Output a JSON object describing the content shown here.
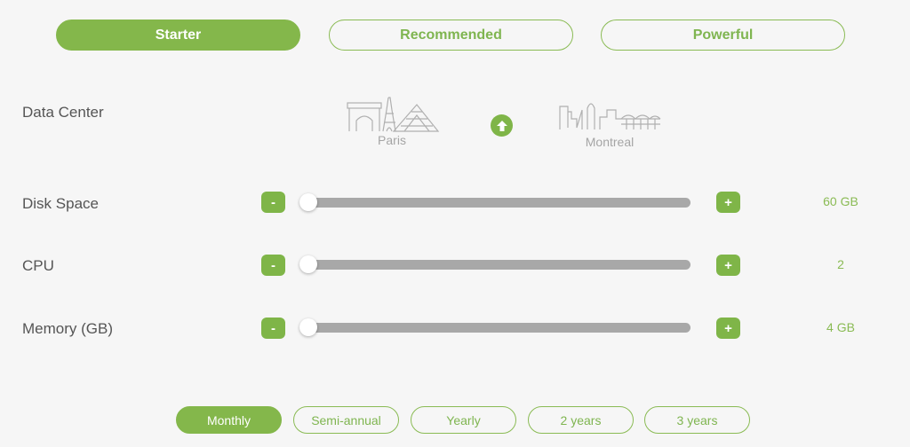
{
  "plans": [
    {
      "label": "Starter",
      "active": true
    },
    {
      "label": "Recommended",
      "active": false
    },
    {
      "label": "Powerful",
      "active": false
    }
  ],
  "data_center": {
    "label": "Data Center",
    "cities": [
      "Paris",
      "Montreal"
    ],
    "swap_icon": "arrow-up-icon"
  },
  "resources": [
    {
      "label": "Disk Space",
      "value": "60 GB",
      "slider_fraction": 0,
      "minus": "-",
      "plus": "+"
    },
    {
      "label": "CPU",
      "value": "2",
      "slider_fraction": 0,
      "minus": "-",
      "plus": "+"
    },
    {
      "label": "Memory (GB)",
      "value": "4 GB",
      "slider_fraction": 0,
      "minus": "-",
      "plus": "+"
    }
  ],
  "periods": [
    {
      "label": "Monthly",
      "active": true
    },
    {
      "label": "Semi-annual",
      "active": false
    },
    {
      "label": "Yearly",
      "active": false
    },
    {
      "label": "2 years",
      "active": false
    },
    {
      "label": "3 years",
      "active": false
    }
  ],
  "colors": {
    "accent": "#84b74b",
    "track": "#a8a8a8",
    "text": "#555555"
  }
}
